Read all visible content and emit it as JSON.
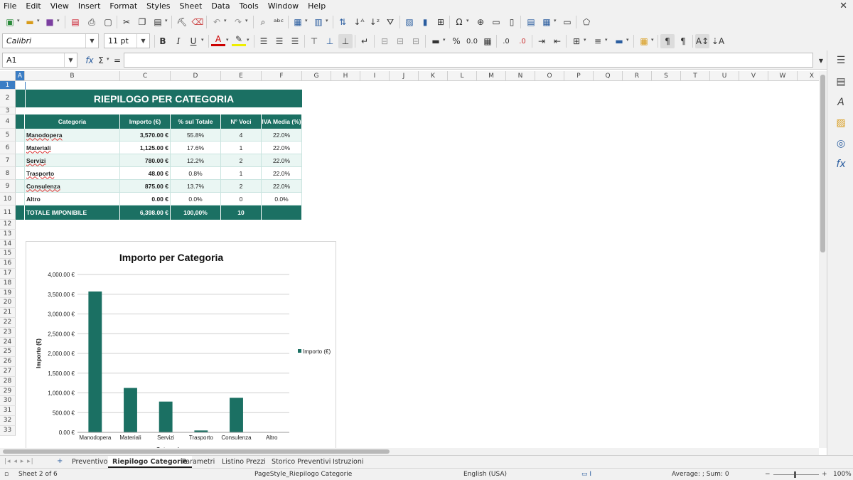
{
  "menu": [
    "File",
    "Edit",
    "View",
    "Insert",
    "Format",
    "Styles",
    "Sheet",
    "Data",
    "Tools",
    "Window",
    "Help"
  ],
  "font": {
    "name": "Calibri",
    "size": "11 pt"
  },
  "formula": {
    "cell_ref": "A1",
    "content": ""
  },
  "columns": [
    "A",
    "B",
    "C",
    "D",
    "E",
    "F",
    "G",
    "H",
    "I",
    "J",
    "K",
    "L",
    "M",
    "N",
    "O",
    "P",
    "Q",
    "R",
    "S",
    "T",
    "U",
    "V",
    "W",
    "X"
  ],
  "rows": [
    "1",
    "2",
    "3",
    "4",
    "5",
    "6",
    "7",
    "8",
    "9",
    "10",
    "11",
    "12",
    "13",
    "14",
    "15",
    "16",
    "17",
    "18",
    "19",
    "20",
    "21",
    "22",
    "23",
    "24",
    "25",
    "26",
    "27",
    "28",
    "29",
    "30",
    "31",
    "32",
    "33"
  ],
  "sheet": {
    "title": "RIEPILOGO PER CATEGORIA",
    "headers": [
      "Categoria",
      "Importo (€)",
      "% sul Totale",
      "N° Voci",
      "IVA Media (%)"
    ],
    "data_rows": [
      [
        "Manodopera",
        "3,570.00 €",
        "55.8%",
        "4",
        "22.0%"
      ],
      [
        "Materiali",
        "1,125.00 €",
        "17.6%",
        "1",
        "22.0%"
      ],
      [
        "Servizi",
        "780.00 €",
        "12.2%",
        "2",
        "22.0%"
      ],
      [
        "Trasporto",
        "48.00 €",
        "0.8%",
        "1",
        "22.0%"
      ],
      [
        "Consulenza",
        "875.00 €",
        "13.7%",
        "2",
        "22.0%"
      ],
      [
        "Altro",
        "0.00 €",
        "0.0%",
        "0",
        "0.0%"
      ]
    ],
    "total_row": [
      "TOTALE IMPONIBILE",
      "6,398.00 €",
      "100,00%",
      "10",
      ""
    ]
  },
  "chart_data": {
    "type": "bar",
    "title": "Importo per Categoria",
    "categories": [
      "Manodopera",
      "Materiali",
      "Servizi",
      "Trasporto",
      "Consulenza",
      "Altro"
    ],
    "series": [
      {
        "name": "Importo (€)",
        "values": [
          3570,
          1125,
          780,
          48,
          875,
          0
        ]
      }
    ],
    "ylabel": "Importo (€)",
    "xlabel": "Categoria",
    "ylim": [
      0,
      4000
    ],
    "yticks": [
      "0.00 €",
      "500.00 €",
      "1,000.00 €",
      "1,500.00 €",
      "2,000.00 €",
      "2,500.00 €",
      "3,000.00 €",
      "3,500.00 €",
      "4,000.00 €"
    ],
    "legend": "right",
    "grid": true,
    "color": "#1b7063"
  },
  "tabs": [
    "Preventivo",
    "Riepilogo Categorie",
    "Parametri",
    "Listino Prezzi",
    "Storico Preventivi",
    "Istruzioni"
  ],
  "active_tab": "Riepilogo Categorie",
  "status": {
    "sheet": "Sheet 2 of 6",
    "pagestyle": "PageStyle_Riepilogo Categorie",
    "language": "English (USA)",
    "sum": "Average: ; Sum: 0",
    "zoom": "100%"
  }
}
